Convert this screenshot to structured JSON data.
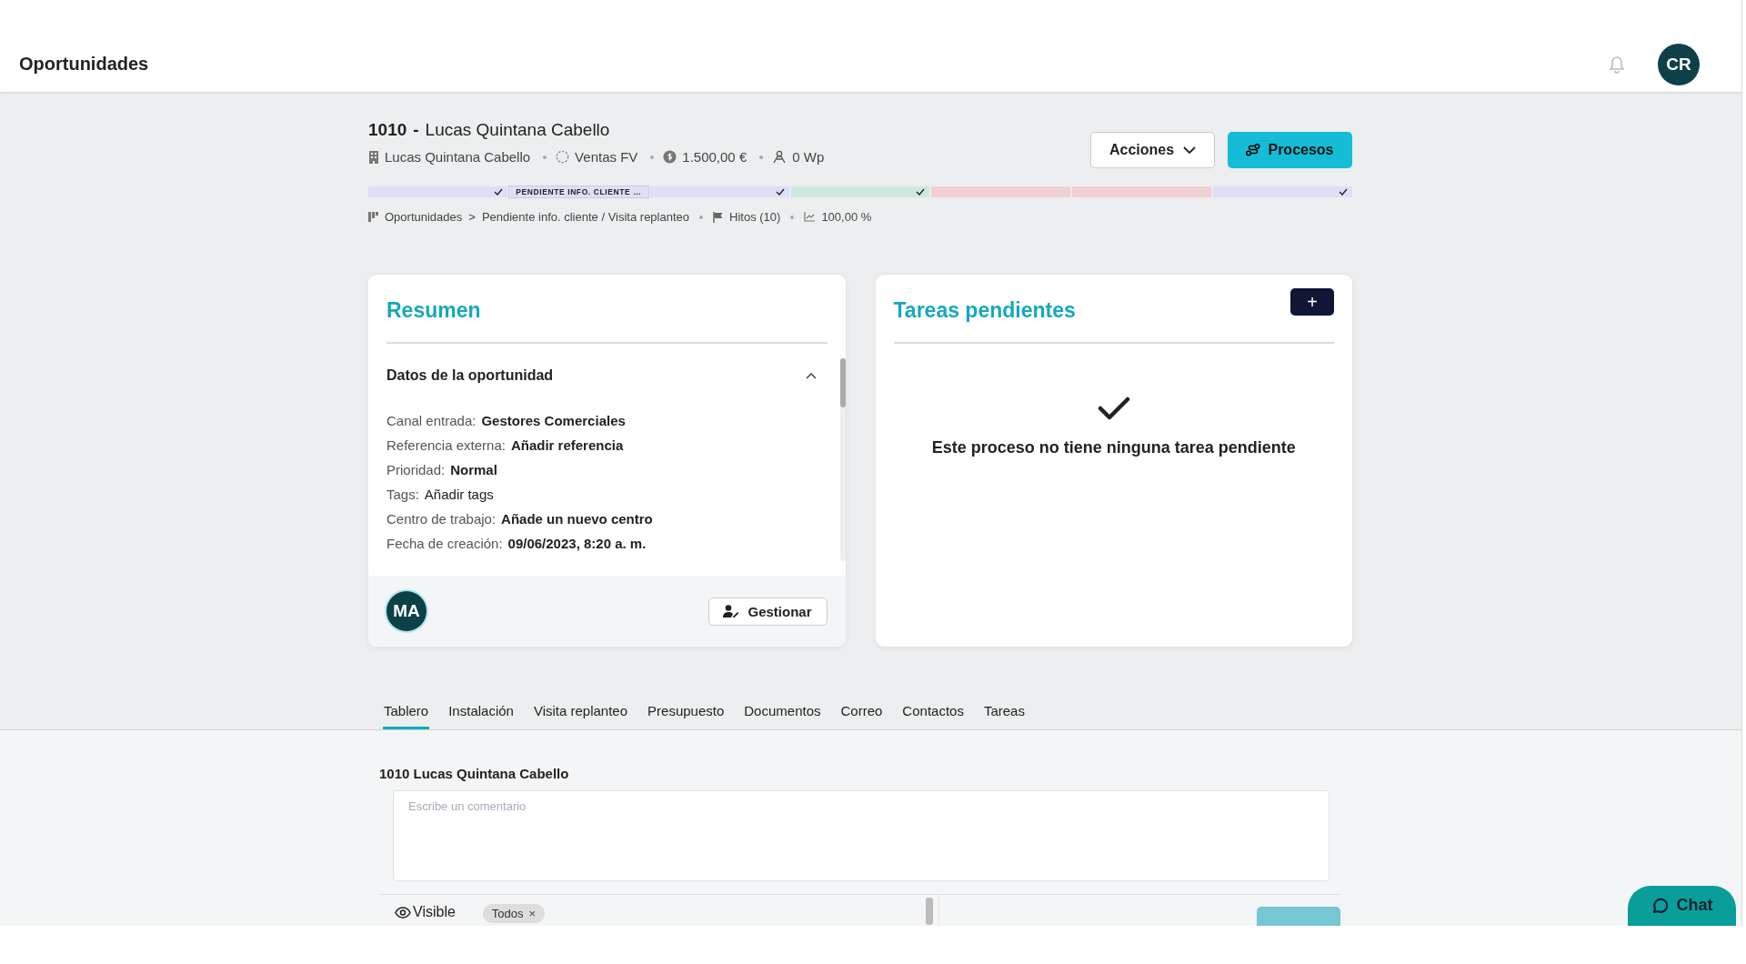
{
  "header": {
    "title": "Oportunidades",
    "avatar": "CR"
  },
  "opportunity": {
    "number": "1010",
    "separator": "-",
    "name": "Lucas Quintana Cabello",
    "meta": [
      {
        "kind": "building",
        "text": "Lucas Quintana Cabello"
      },
      {
        "kind": "pipeline",
        "text": "Ventas FV"
      },
      {
        "kind": "money",
        "text": "1.500,00 €"
      },
      {
        "kind": "power",
        "text": "0 Wp"
      }
    ]
  },
  "actions": {
    "menu": "Acciones",
    "primary": "Procesos"
  },
  "stages": [
    {
      "color": "#dde0f6",
      "checked": true,
      "selected": false
    },
    {
      "color": "#dde0f6",
      "checked": false,
      "selected": true,
      "label": "PENDIENTE INFO. CLIENTE …"
    },
    {
      "color": "#dde0f6",
      "checked": true,
      "selected": false
    },
    {
      "color": "#cde9df",
      "checked": true,
      "selected": false
    },
    {
      "color": "#f1d0d3",
      "checked": false,
      "selected": false
    },
    {
      "color": "#f1d0d3",
      "checked": false,
      "selected": false
    },
    {
      "color": "#dde0f6",
      "checked": true,
      "selected": false
    }
  ],
  "breadcrumb": {
    "root": "Oportunidades",
    "chevron": ">",
    "current": "Pendiente info. cliente / Visita replanteo",
    "milestones": "Hitos (10)",
    "progress": "100,00 %"
  },
  "summary": {
    "title": "Resumen",
    "section": "Datos de la oportunidad",
    "expanded": true,
    "fields": [
      {
        "label": "Canal entrada:",
        "value": "Gestores Comerciales",
        "bold": true
      },
      {
        "label": "Referencia externa:",
        "value": "Añadir referencia",
        "bold": true
      },
      {
        "label": "Prioridad:",
        "value": "Normal",
        "bold": true
      },
      {
        "label": "Tags:",
        "value": "Añadir tags",
        "bold": false
      },
      {
        "label": "Centro de trabajo:",
        "value": "Añade un nuevo centro",
        "bold": true
      },
      {
        "label": "Fecha de creación:",
        "value": "09/06/2023, 8:20 a. m.",
        "bold": true
      }
    ],
    "assignee": "MA",
    "manage": "Gestionar"
  },
  "tasks": {
    "title": "Tareas pendientes",
    "add": "+",
    "empty": "Este proceso no tiene ninguna tarea pendiente"
  },
  "tabs": [
    {
      "label": "Tablero",
      "selected": true
    },
    {
      "label": "Instalación",
      "selected": false
    },
    {
      "label": "Visita replanteo",
      "selected": false
    },
    {
      "label": "Presupuesto",
      "selected": false
    },
    {
      "label": "Documentos",
      "selected": false
    },
    {
      "label": "Correo",
      "selected": false
    },
    {
      "label": "Contactos",
      "selected": false
    },
    {
      "label": "Tareas",
      "selected": false
    }
  ],
  "comment": {
    "title": "1010 Lucas Quintana Cabello",
    "placeholder": "Escribe un comentario",
    "visibility": "Visible",
    "tag": "Todos",
    "tag_remove": "×"
  },
  "chat": "Chat"
}
